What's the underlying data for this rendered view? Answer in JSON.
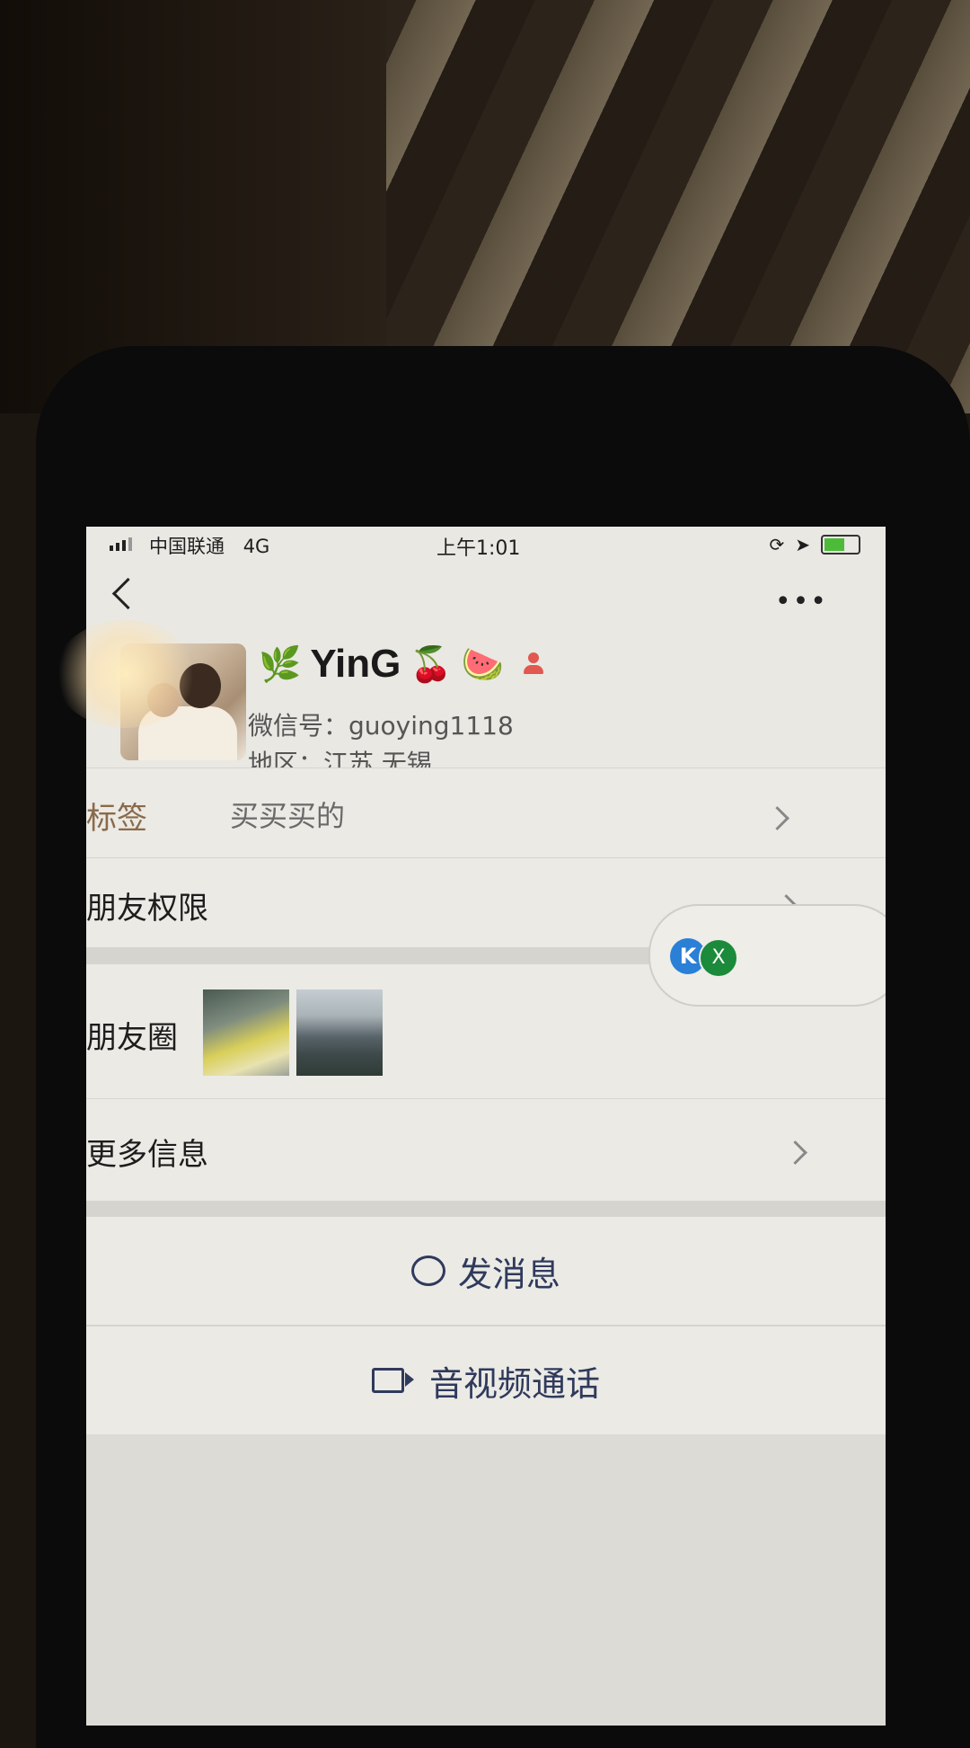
{
  "status_bar": {
    "carrier": "中国联通",
    "network": "4G",
    "time": "上午1:01"
  },
  "profile": {
    "nickname": "YinG",
    "emoji_prefix": "🌿",
    "emoji_suffix_1": "🍒",
    "emoji_suffix_2": "🍉",
    "wechat_id_label": "微信号：",
    "wechat_id": "guoying1118",
    "region_label": "地区：",
    "region": "江苏 无锡"
  },
  "rows": {
    "tags_label": "标签",
    "tags_value": "买买买的",
    "permissions_label": "朋友权限",
    "moments_label": "朋友圈",
    "more_info_label": "更多信息"
  },
  "widget": {
    "k_label": "K",
    "x_label": "X"
  },
  "actions": {
    "send_message": "发消息",
    "video_call": "音视频通话"
  },
  "colors": {
    "action_text": "#2f3a5c",
    "gender_icon": "#e0584f"
  }
}
